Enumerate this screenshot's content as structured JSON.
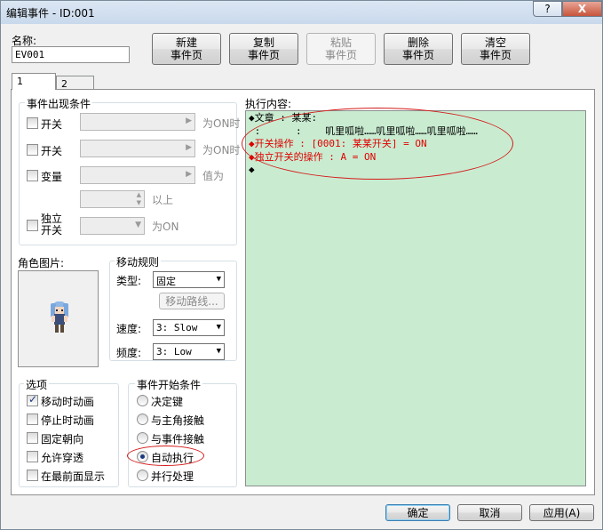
{
  "window": {
    "title": "编辑事件 - ID:001",
    "help_label": "?",
    "close_label": "X"
  },
  "name": {
    "label": "名称:",
    "value": "EV001"
  },
  "toolbar": [
    {
      "line1": "新建",
      "line2": "事件页",
      "enabled": true
    },
    {
      "line1": "复制",
      "line2": "事件页",
      "enabled": true
    },
    {
      "line1": "粘贴",
      "line2": "事件页",
      "enabled": false
    },
    {
      "line1": "删除",
      "line2": "事件页",
      "enabled": true
    },
    {
      "line1": "清空",
      "line2": "事件页",
      "enabled": true
    }
  ],
  "tabs": [
    "1",
    "2"
  ],
  "conditions": {
    "title": "事件出现条件",
    "switch1": {
      "label": "开关",
      "suffix": "为ON时"
    },
    "switch2": {
      "label": "开关",
      "suffix": "为ON时"
    },
    "variable": {
      "label": "变量",
      "suffix": "值为",
      "suffix2": "以上"
    },
    "self_switch": {
      "label_line1": "独立",
      "label_line2": "开关",
      "suffix": "为ON"
    }
  },
  "graphic": {
    "title": "角色图片:"
  },
  "movement": {
    "title": "移动规则",
    "type_label": "类型:",
    "type_value": "固定",
    "route_label": "移动路线...",
    "speed_label": "速度:",
    "speed_value": "3: Slow",
    "freq_label": "频度:",
    "freq_value": "3: Low"
  },
  "options": {
    "title": "选项",
    "items": [
      {
        "label": "移动时动画",
        "checked": true
      },
      {
        "label": "停止时动画",
        "checked": false
      },
      {
        "label": "固定朝向",
        "checked": false
      },
      {
        "label": "允许穿透",
        "checked": false
      },
      {
        "label": "在最前面显示",
        "checked": false
      }
    ]
  },
  "trigger": {
    "title": "事件开始条件",
    "items": [
      {
        "label": "决定键",
        "selected": false
      },
      {
        "label": "与主角接触",
        "selected": false
      },
      {
        "label": "与事件接触",
        "selected": false
      },
      {
        "label": "自动执行",
        "selected": true
      },
      {
        "label": "并行处理",
        "selected": false
      }
    ]
  },
  "contents": {
    "title": "执行内容:",
    "lines": [
      {
        "text": "◆文章 : 某某:",
        "red": false
      },
      {
        "text": " :      :    叽里呱啦……叽里呱啦……叽里呱啦……",
        "red": false
      },
      {
        "text": "◆开关操作 : [0001: 某某开关] = ON",
        "red": true
      },
      {
        "text": "◆独立开关的操作 : A = ON",
        "red": true
      },
      {
        "text": "◆",
        "red": false
      }
    ]
  },
  "footer": {
    "ok": "确定",
    "cancel": "取消",
    "apply": "应用(A)"
  },
  "colors": {
    "content_bg": "#c9ecd1",
    "highlight_red": "#e00000",
    "annotation": "#d41a1a"
  }
}
